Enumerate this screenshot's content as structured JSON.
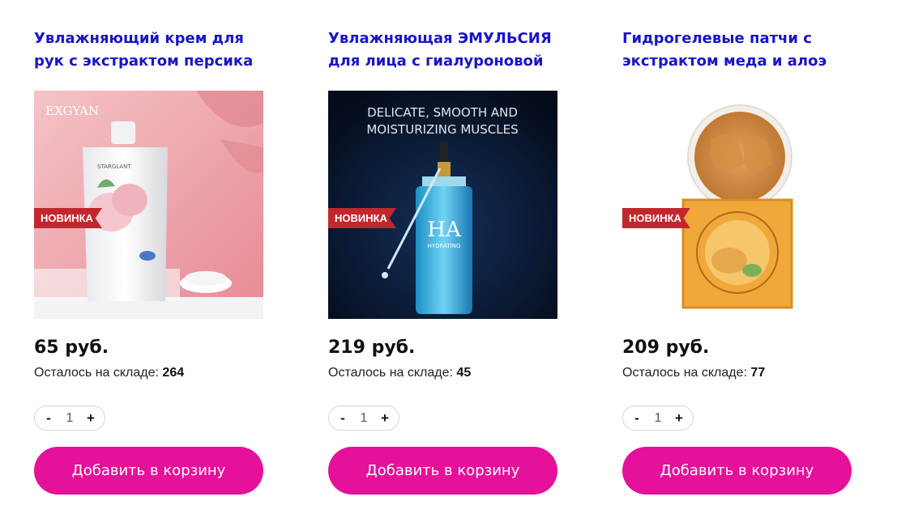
{
  "colors": {
    "title": "#1a14c9",
    "cart_button": "#e5119a",
    "badge": "#c0282e"
  },
  "products": [
    {
      "title": "Увлажняющий крем для рук с экстрактом персика",
      "badge": "НОВИНКА",
      "image_brand": "EXGYAN",
      "image_sub": "STARGLANT",
      "price": "65 руб.",
      "stock_label": "Осталось на складе:",
      "stock": "264",
      "qty": "1",
      "minus": "-",
      "plus": "+",
      "cart_label": "Добавить в корзину"
    },
    {
      "title": "Увлажняющая ЭМУЛЬСИЯ для лица с гиалуроновой",
      "badge": "НОВИНКА",
      "image_text_1": "DELICATE, SMOOTH AND",
      "image_text_2": "MOISTURIZING MUSCLES",
      "image_bottle": "HA",
      "image_bottle_sub": "HYDRATING",
      "price": "219 руб.",
      "stock_label": "Осталось на складе:",
      "stock": "45",
      "qty": "1",
      "minus": "-",
      "plus": "+",
      "cart_label": "Добавить в корзину"
    },
    {
      "title": "Гидрогелевые патчи с экстрактом меда и алоэ",
      "badge": "НОВИНКА",
      "price": "209 руб.",
      "stock_label": "Осталось на складе:",
      "stock": "77",
      "qty": "1",
      "minus": "-",
      "plus": "+",
      "cart_label": "Добавить в корзину"
    }
  ]
}
